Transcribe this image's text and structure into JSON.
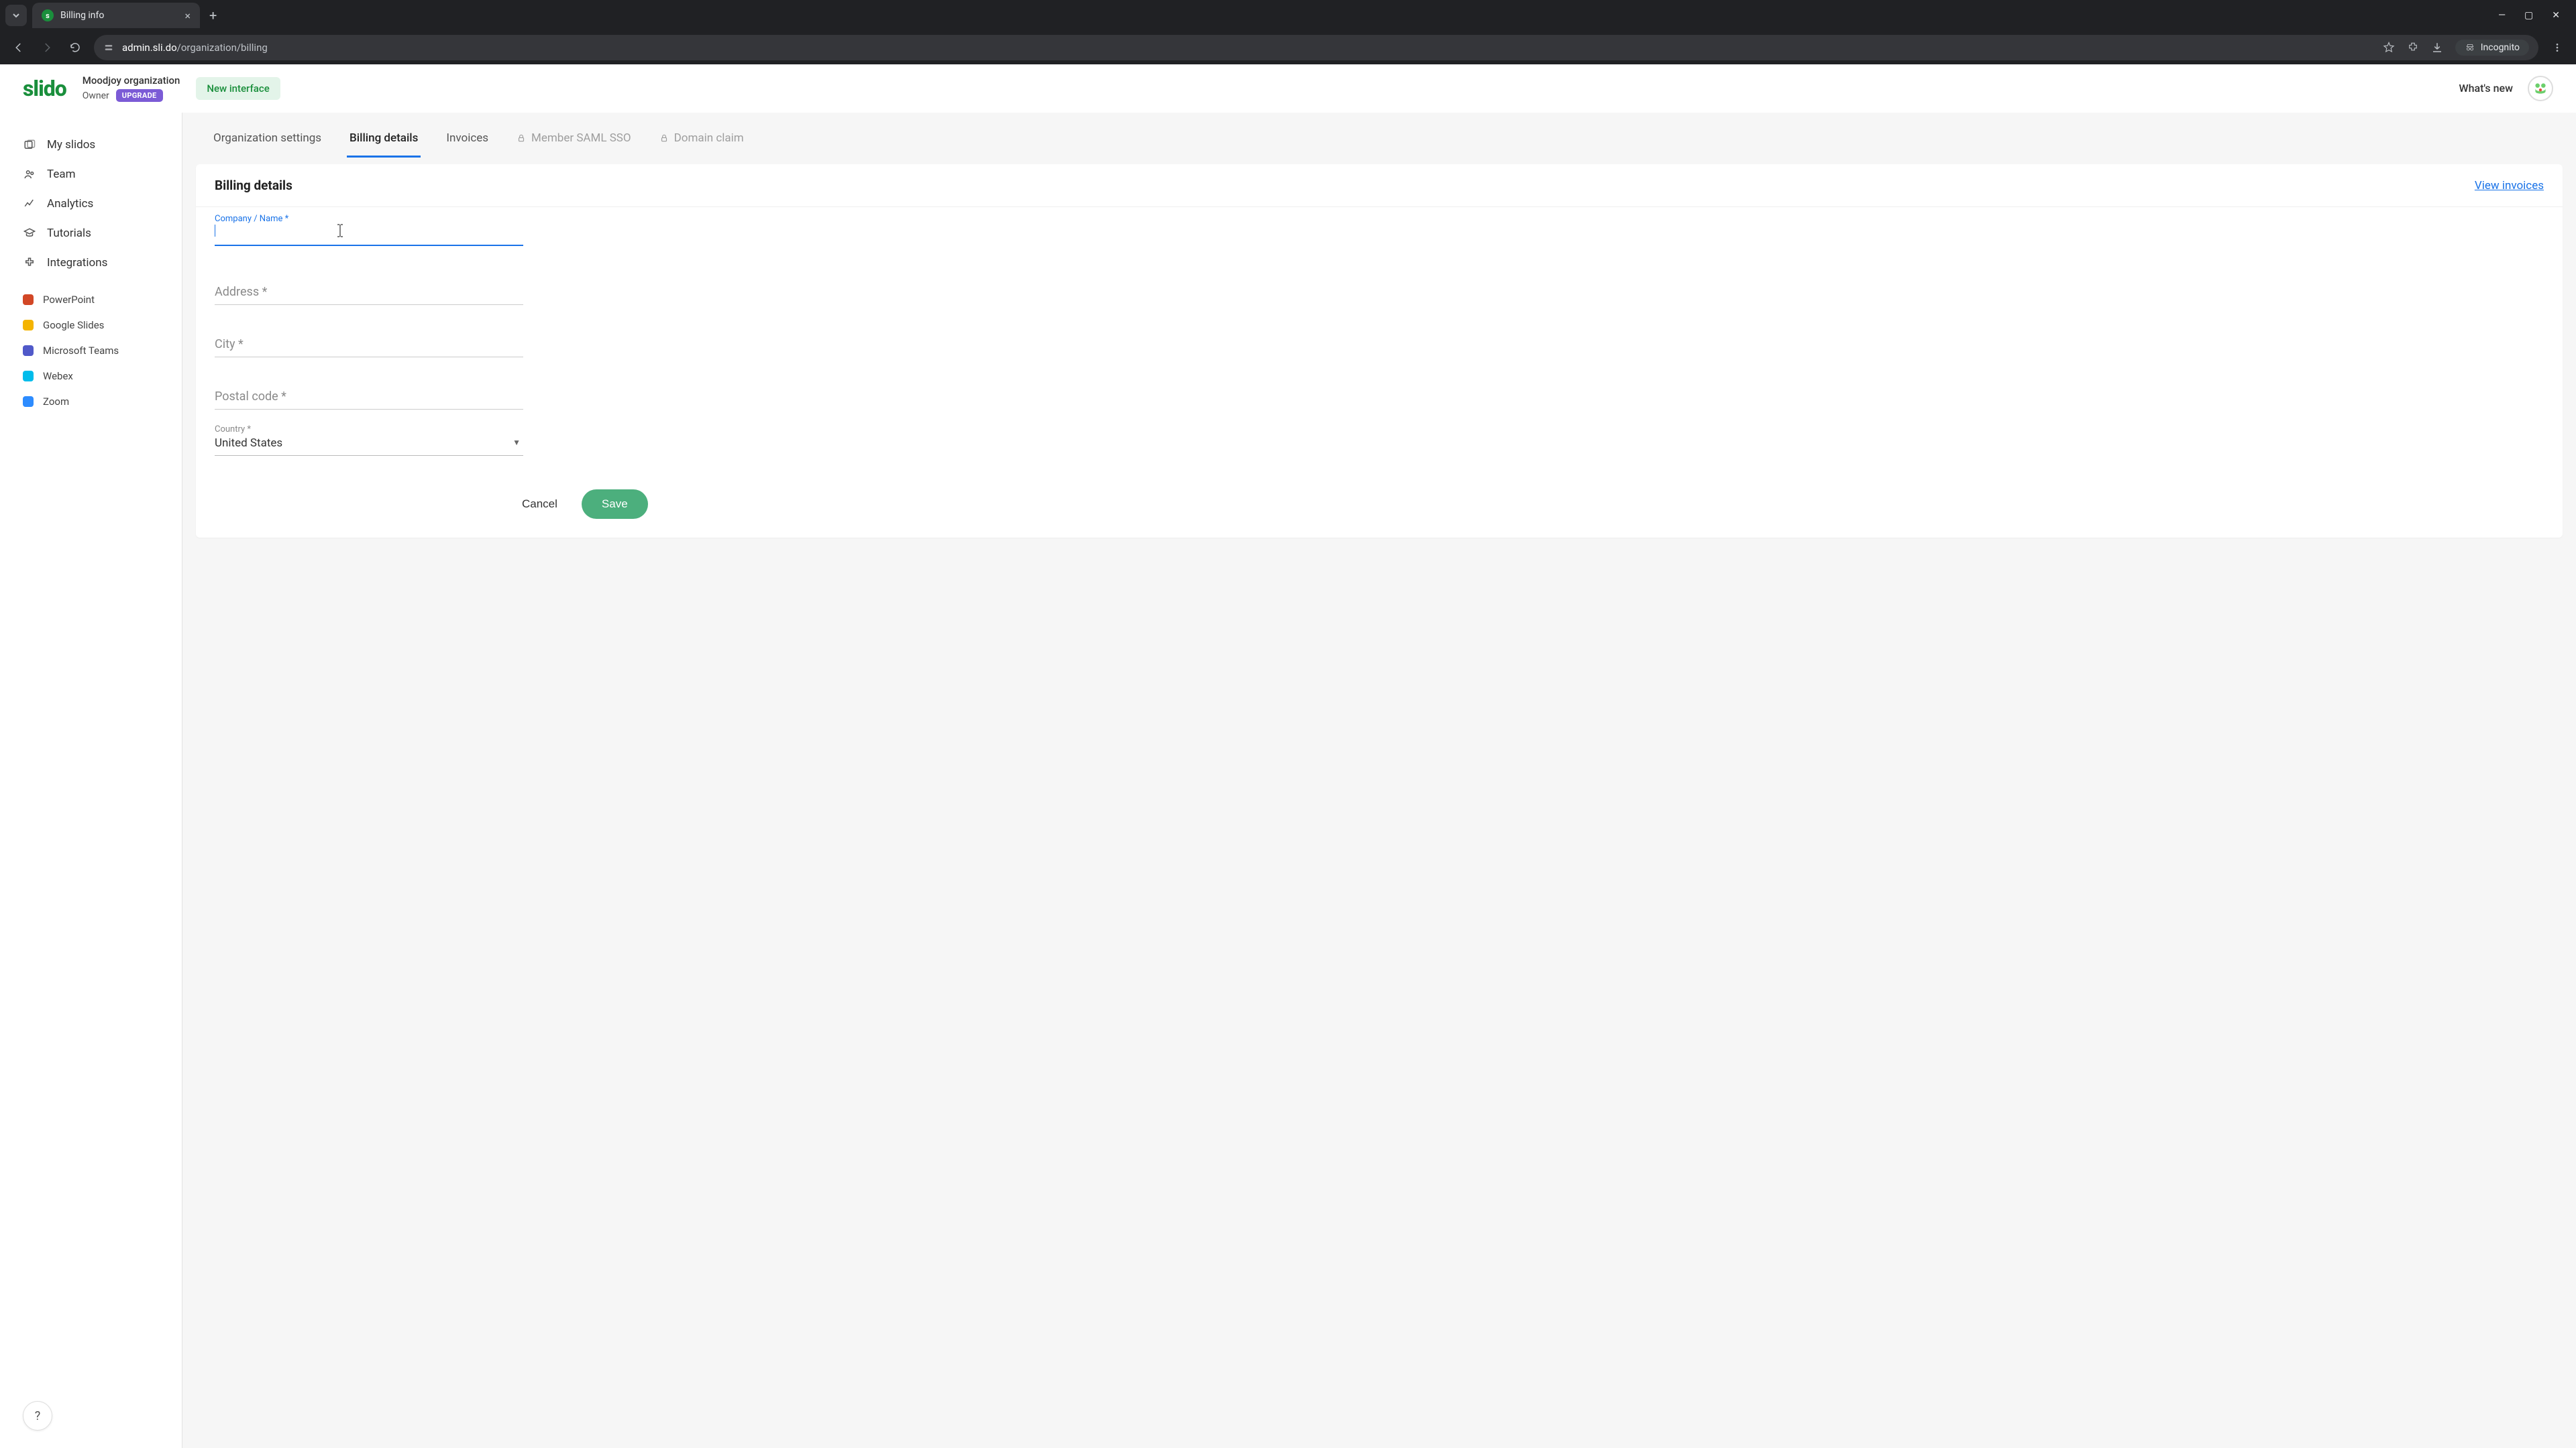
{
  "browser": {
    "tab_title": "Billing info",
    "url_domain": "admin.sli.do",
    "url_path": "/organization/billing",
    "incognito_label": "Incognito"
  },
  "header": {
    "logo": "slido",
    "org_name": "Moodjoy organization",
    "role": "Owner",
    "upgrade": "UPGRADE",
    "new_interface": "New interface",
    "whats_new": "What's new"
  },
  "sidebar": {
    "items": [
      {
        "label": "My slidos"
      },
      {
        "label": "Team"
      },
      {
        "label": "Analytics"
      },
      {
        "label": "Tutorials"
      },
      {
        "label": "Integrations"
      }
    ],
    "integrations": [
      {
        "label": "PowerPoint"
      },
      {
        "label": "Google Slides"
      },
      {
        "label": "Microsoft Teams"
      },
      {
        "label": "Webex"
      },
      {
        "label": "Zoom"
      }
    ],
    "help": "?"
  },
  "tabs": {
    "org_settings": "Organization settings",
    "billing_details": "Billing details",
    "invoices": "Invoices",
    "member_sso": "Member SAML SSO",
    "domain_claim": "Domain claim"
  },
  "card": {
    "title": "Billing details",
    "view_invoices": "View invoices"
  },
  "form": {
    "company_label": "Company / Name *",
    "company_value": "",
    "address_placeholder": "Address *",
    "city_placeholder": "City *",
    "postal_placeholder": "Postal code *",
    "country_label": "Country *",
    "country_value": "United States"
  },
  "actions": {
    "cancel": "Cancel",
    "save": "Save"
  }
}
